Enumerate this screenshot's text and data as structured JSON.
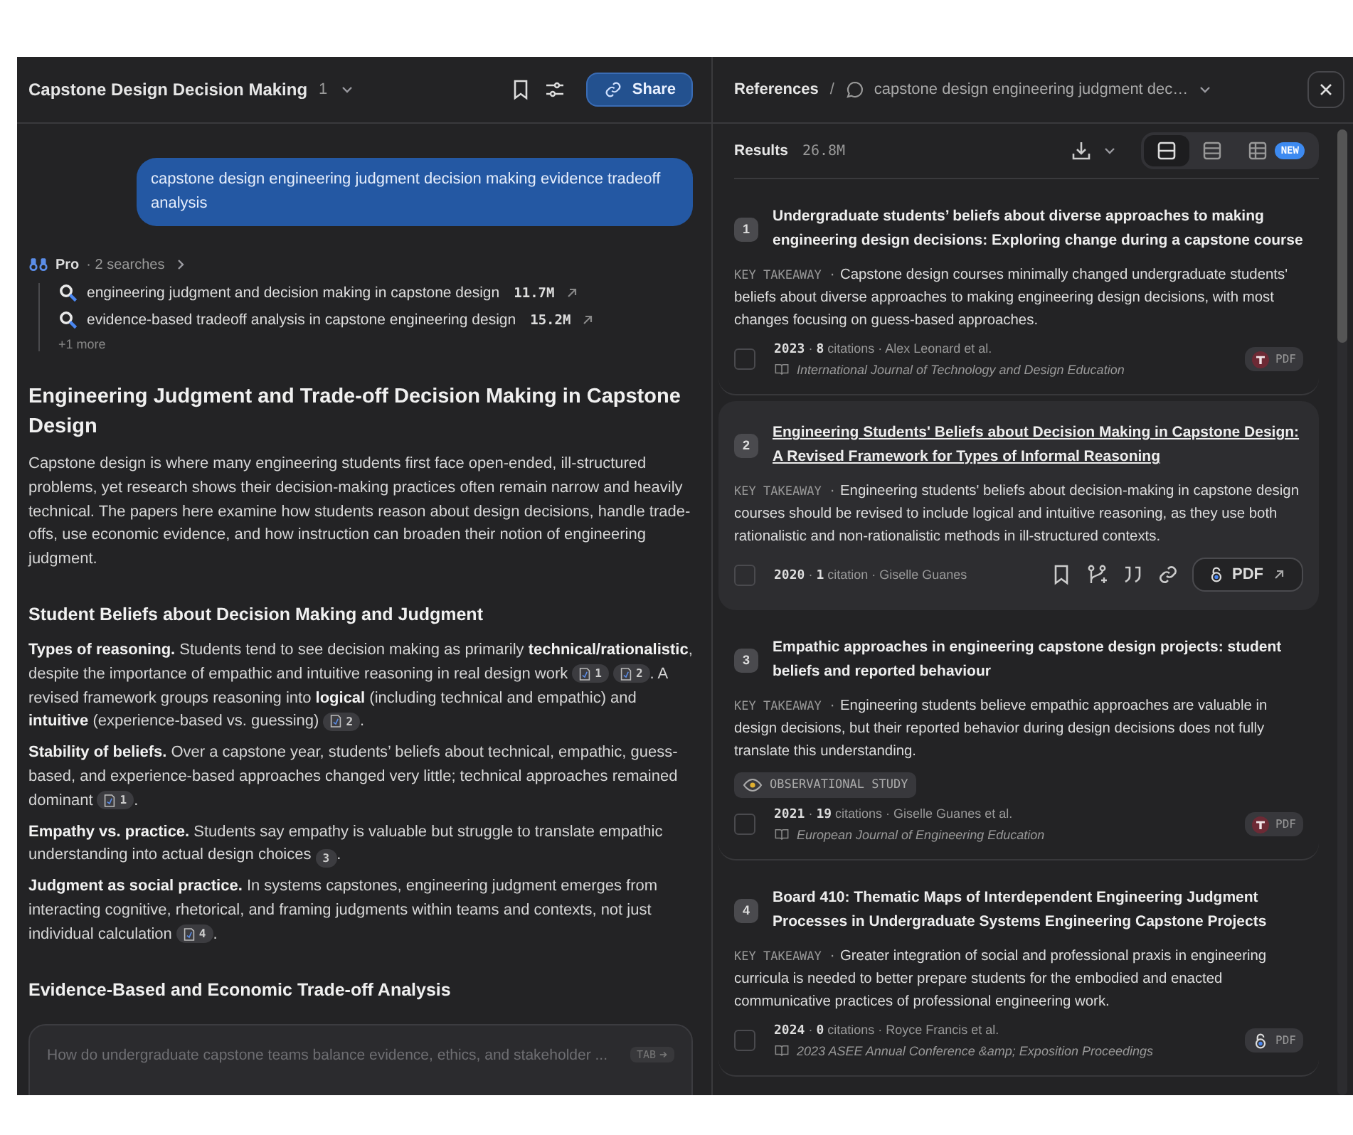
{
  "chat": {
    "title": "Capstone Design Decision Making",
    "count": "1",
    "share": "Share",
    "query": "capstone design engineering judgment decision making evidence tradeoff analysis",
    "pro": {
      "label": "Pro",
      "searches": "· 2 searches",
      "expanded": false,
      "items": [
        {
          "text": "engineering judgment and decision making in capstone design",
          "count": "11.7M"
        },
        {
          "text": "evidence-based tradeoff analysis in capstone engineering design",
          "count": "15.2M"
        }
      ],
      "more": "+1 more"
    },
    "heading": "Engineering Judgment and Trade-off Decision Making in Capstone Design",
    "intro": "Capstone design is where many engineering students first face open-ended, ill-structured problems, yet research shows their decision-making practices often remain narrow and heavily technical. The papers here examine how students reason about design decisions, handle trade-offs, use economic evidence, and how instruction can broaden their notion of engineering judgment.",
    "sections": [
      {
        "title": "Student Beliefs about Decision Making and Judgment",
        "paragraphs": [
          [
            {
              "kind": "text",
              "text": "**Types of reasoning.** Students tend to see decision making as primarily **technical/rationalistic**, despite the importance of empathic and intuitive reasoning in real design work"
            },
            {
              "kind": "cite",
              "label": "1",
              "has_pdf": true
            },
            {
              "kind": "cite",
              "label": "2",
              "has_pdf": true
            },
            {
              "kind": "text",
              "text": ". A revised framework groups reasoning into **logical** (including technical and empathic) and **intuitive** (experience-based vs. guessing)"
            },
            {
              "kind": "cite",
              "label": "2",
              "has_pdf": true
            },
            {
              "kind": "text",
              "text": "."
            }
          ],
          [
            {
              "kind": "text",
              "text": "**Stability of beliefs.** Over a capstone year, students’ beliefs about technical, empathic, guess-based, and experience-based approaches changed very little; technical approaches remained dominant"
            },
            {
              "kind": "cite",
              "label": "1",
              "has_pdf": true
            },
            {
              "kind": "text",
              "text": "."
            }
          ],
          [
            {
              "kind": "text",
              "text": "**Empathy vs. practice.** Students say empathy is valuable but struggle to translate empathic understanding into actual design choices"
            },
            {
              "kind": "cite",
              "label": "3",
              "has_pdf": false
            },
            {
              "kind": "text",
              "text": "."
            }
          ],
          [
            {
              "kind": "text",
              "text": "**Judgment as social practice.** In systems capstones, engineering judgment emerges from interacting cognitive, rhetorical, and framing judgments within teams and contexts, not just individual calculation"
            },
            {
              "kind": "cite",
              "label": "4",
              "has_pdf": true
            },
            {
              "kind": "text",
              "text": "."
            }
          ]
        ]
      },
      {
        "title": "Evidence-Based and Economic Trade-off Analysis"
      }
    ],
    "input": {
      "placeholder": "How do undergraduate capstone teams balance evidence, ethics, and stakeholder ...",
      "key": "TAB"
    }
  },
  "references": {
    "title": "References",
    "separator": "/",
    "crumb": "capstone design engineering judgment dec…",
    "results_label": "Results",
    "results_count": "26.8M",
    "views": [
      {
        "kind": "cards",
        "selected": true
      },
      {
        "kind": "list",
        "selected": false
      },
      {
        "kind": "table",
        "selected": false,
        "badge": "NEW"
      }
    ],
    "papers": [
      {
        "number": "1",
        "title": "Undergraduate students’ beliefs about diverse approaches to making engineering design decisions: Exploring change during a capstone course",
        "takeaway_label": "KEY TAKEAWAY ·",
        "takeaway": "Capstone design courses minimally changed undergraduate students' beliefs about diverse approaches to making engineering design decisions, with most changes focusing on guess-based approaches.",
        "meta": "**2023** · **8** citations · Alex Leonard et al.",
        "journal": "International Journal of Technology and Design Education",
        "pdf": {
          "label": "PDF",
          "kind": "institution"
        },
        "hovered": false,
        "checked": false
      },
      {
        "number": "2",
        "title": "Engineering Students' Beliefs about Decision Making in Capstone Design: A Revised Framework for Types of Informal Reasoning",
        "takeaway_label": "KEY TAKEAWAY ·",
        "takeaway": "Engineering students' beliefs about decision-making in capstone design courses should be revised to include logical and intuitive reasoning, as they use both rationalistic and non-rationalistic methods in ill-structured contexts.",
        "meta": "**2020** · **1** citation · Giselle Guanes",
        "pdf": {
          "label": "PDF",
          "kind": "open_access"
        },
        "hovered": true,
        "checked": false
      },
      {
        "number": "3",
        "title": "Empathic approaches in engineering capstone design projects: student beliefs and reported behaviour",
        "takeaway_label": "KEY TAKEAWAY ·",
        "takeaway": "Engineering students believe empathic approaches are valuable in design decisions, but their reported behavior during design decisions does not fully translate this understanding.",
        "tag": "OBSERVATIONAL STUDY",
        "meta": "**2021** · **19** citations · Giselle Guanes et al.",
        "journal": "European Journal of Engineering Education",
        "pdf": {
          "label": "PDF",
          "kind": "institution"
        },
        "hovered": false,
        "checked": false
      },
      {
        "number": "4",
        "title": "Board 410: Thematic Maps of Interdependent Engineering Judgment Processes in Undergraduate Systems Engineering Capstone Projects",
        "takeaway_label": "KEY TAKEAWAY ·",
        "takeaway": "Greater integration of social and professional praxis in engineering curricula is needed to better prepare students for the embodied and enacted communicative practices of professional engineering work.",
        "meta": "**2024** · **0** citations · Royce Francis et al.",
        "journal": "2023 ASEE Annual Conference &amp; Exposition Proceedings",
        "pdf": {
          "label": "PDF",
          "kind": "open_access"
        },
        "hovered": false,
        "checked": false
      }
    ]
  }
}
